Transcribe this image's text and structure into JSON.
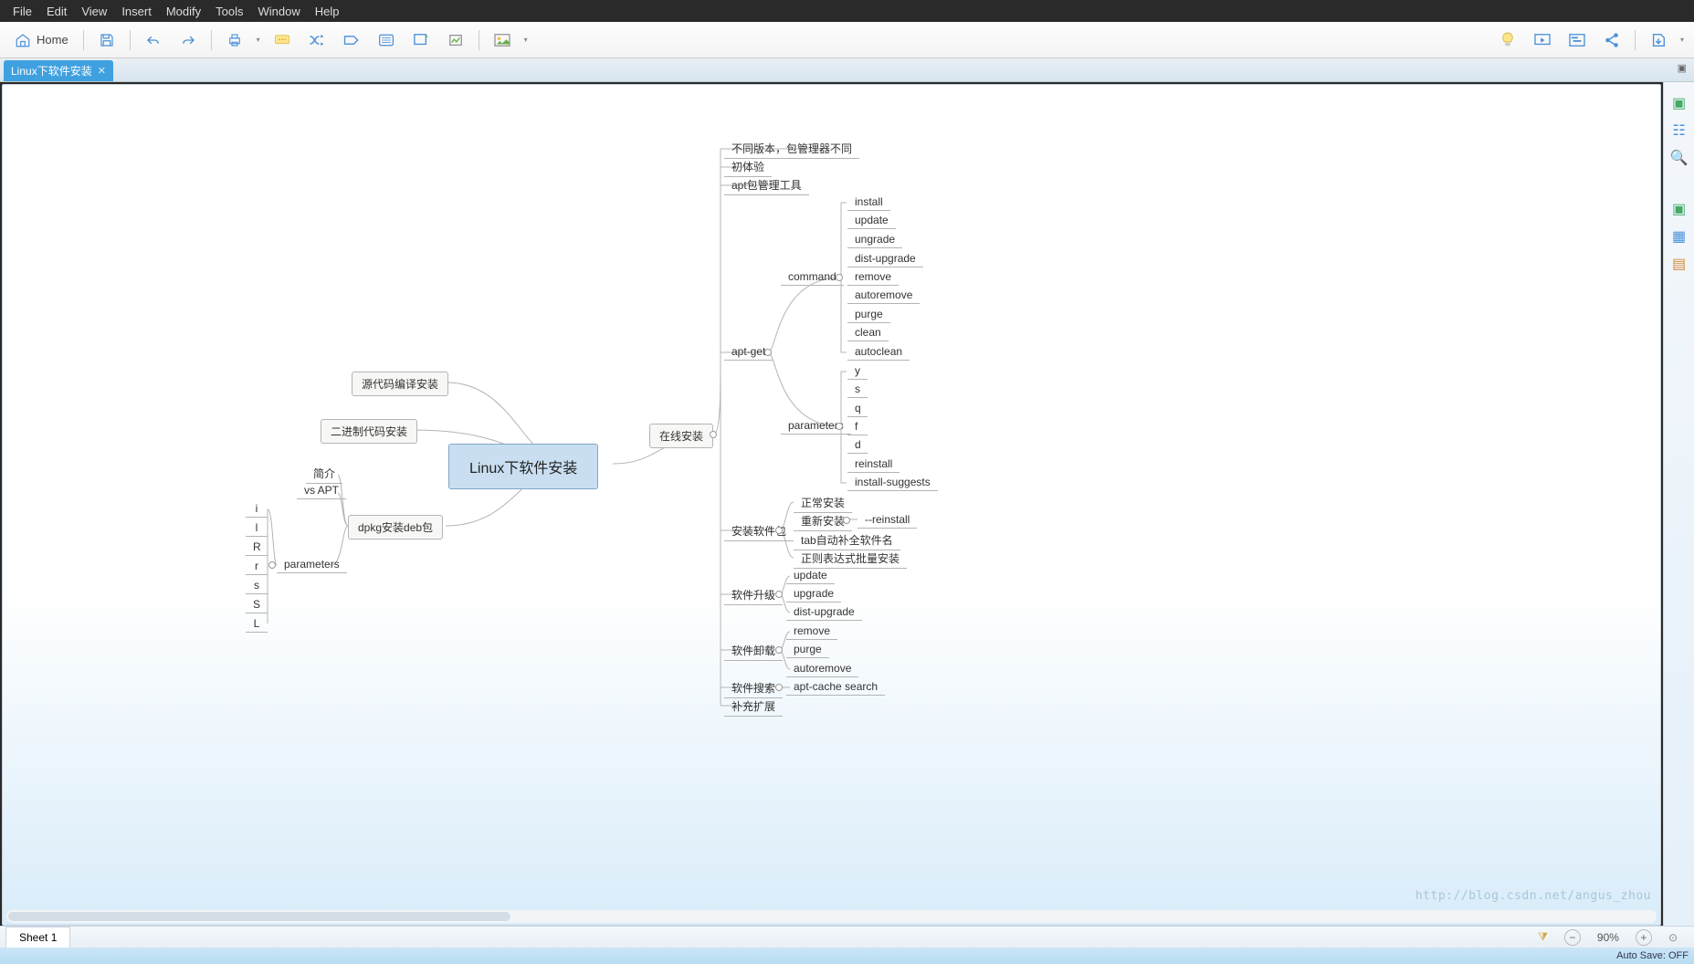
{
  "menu": {
    "items": [
      "File",
      "Edit",
      "View",
      "Insert",
      "Modify",
      "Tools",
      "Window",
      "Help"
    ]
  },
  "toolbar": {
    "home": "Home"
  },
  "tab": {
    "title": "Linux下软件安装"
  },
  "sheet": {
    "name": "Sheet 1"
  },
  "zoom": {
    "percent": "90%"
  },
  "status": {
    "autosave": "Auto Save: OFF"
  },
  "watermark": "http://blog.csdn.net/angus_zhou",
  "mindmap": {
    "center": "Linux下软件安装",
    "left": {
      "l1": "源代码编译安装",
      "l2": "二进制代码安装",
      "l3": "dpkg安装deb包",
      "l3_children": {
        "a": "简介",
        "b": "vs APT",
        "c": "parameters",
        "c_children": [
          "i",
          "l",
          "R",
          "r",
          "s",
          "S",
          "L"
        ]
      }
    },
    "right": {
      "r1": "在线安装",
      "r1_children": {
        "a": "不同版本，包管理器不同",
        "b": "初体验",
        "c": "apt包管理工具",
        "d": "apt-get",
        "d_children": {
          "cmd": "command",
          "cmd_items": [
            "install",
            "update",
            "ungrade",
            "dist-upgrade",
            "remove",
            "autoremove",
            "purge",
            "clean",
            "autoclean"
          ],
          "par": "parameters",
          "par_items": [
            "y",
            "s",
            "q",
            "f",
            "d",
            "reinstall",
            "install-suggests"
          ]
        },
        "e": "安装软件包",
        "e_children": {
          "e1": "正常安装",
          "e2": "重新安装",
          "e2_sub": "--reinstall",
          "e3": "tab自动补全软件名",
          "e4": "正则表达式批量安装"
        },
        "f": "软件升级",
        "f_children": [
          "update",
          "upgrade",
          "dist-upgrade"
        ],
        "g": "软件卸载",
        "g_children": [
          "remove",
          "purge",
          "autoremove"
        ],
        "h": "软件搜索",
        "h_children": [
          "apt-cache search"
        ],
        "i": "补充扩展"
      }
    }
  }
}
